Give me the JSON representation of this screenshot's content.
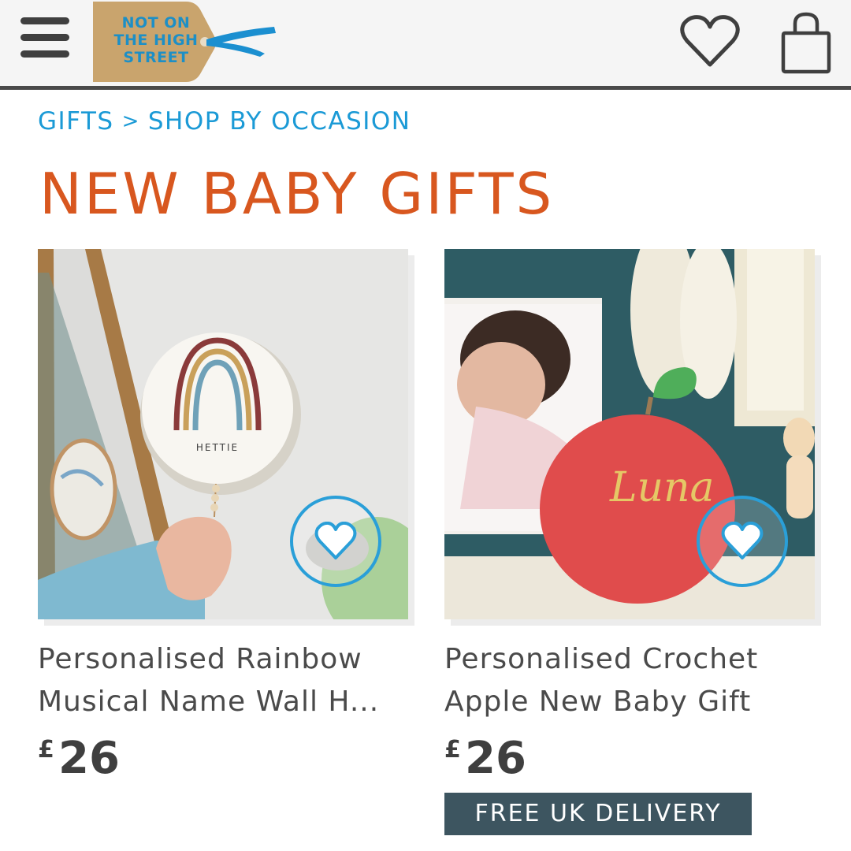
{
  "header": {
    "menu_icon": "hamburger-menu-icon",
    "logo_lines": [
      "NOT ON",
      "THE HIGH",
      "STREET"
    ],
    "wishlist_icon": "heart-outline-icon",
    "bag_icon": "shopping-bag-icon"
  },
  "breadcrumb": {
    "items": [
      "GIFTS",
      "SHOP BY OCCASION"
    ],
    "separator": ">"
  },
  "page_title": "NEW BABY GIFTS",
  "products": [
    {
      "name": "Personalised Rainbow Musical Name Wall H...",
      "currency": "£",
      "price": "26",
      "image_text": "HETTIE",
      "favorite_icon": "heart-favorite-icon"
    },
    {
      "name": "Personalised Crochet Apple New Baby Gift",
      "currency": "£",
      "price": "26",
      "image_text": "Luna",
      "favorite_icon": "heart-favorite-icon",
      "badge": "FREE UK DELIVERY"
    }
  ],
  "colors": {
    "accent_blue": "#1b9ad6",
    "title_orange": "#d8571f",
    "badge_bg": "#3d5560"
  }
}
